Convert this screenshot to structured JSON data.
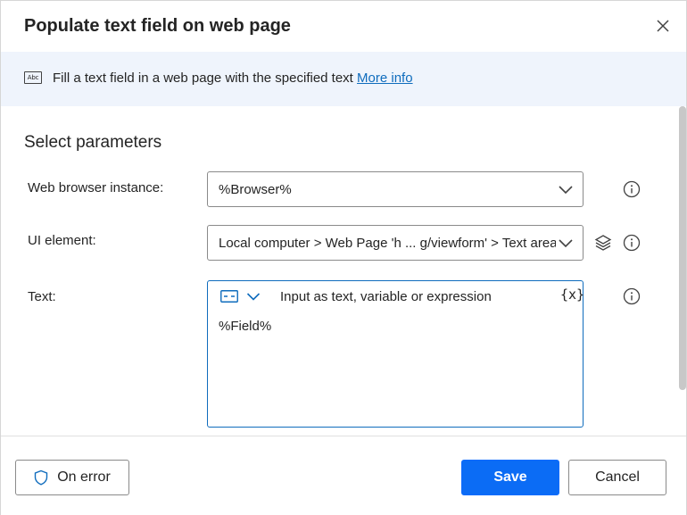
{
  "dialog": {
    "title": "Populate text field on web page",
    "close_icon": "close-icon"
  },
  "banner": {
    "icon_text": "Abc",
    "text": "Fill a text field in a web page with the specified text",
    "link": "More info"
  },
  "params": {
    "section_title": "Select parameters",
    "browser": {
      "label": "Web browser instance:",
      "value": "%Browser%"
    },
    "ui_element": {
      "label": "UI element:",
      "value": "Local computer > Web Page 'h ... g/viewform' > Text area"
    },
    "text": {
      "label": "Text:",
      "placeholder": "Input as text, variable or expression",
      "var_button": "{x}",
      "value": "%Field%"
    }
  },
  "footer": {
    "on_error": "On error",
    "save": "Save",
    "cancel": "Cancel"
  },
  "colors": {
    "accent": "#0f6cbd",
    "banner_bg": "#eff4fc",
    "save_bg": "#0b6cf5"
  }
}
